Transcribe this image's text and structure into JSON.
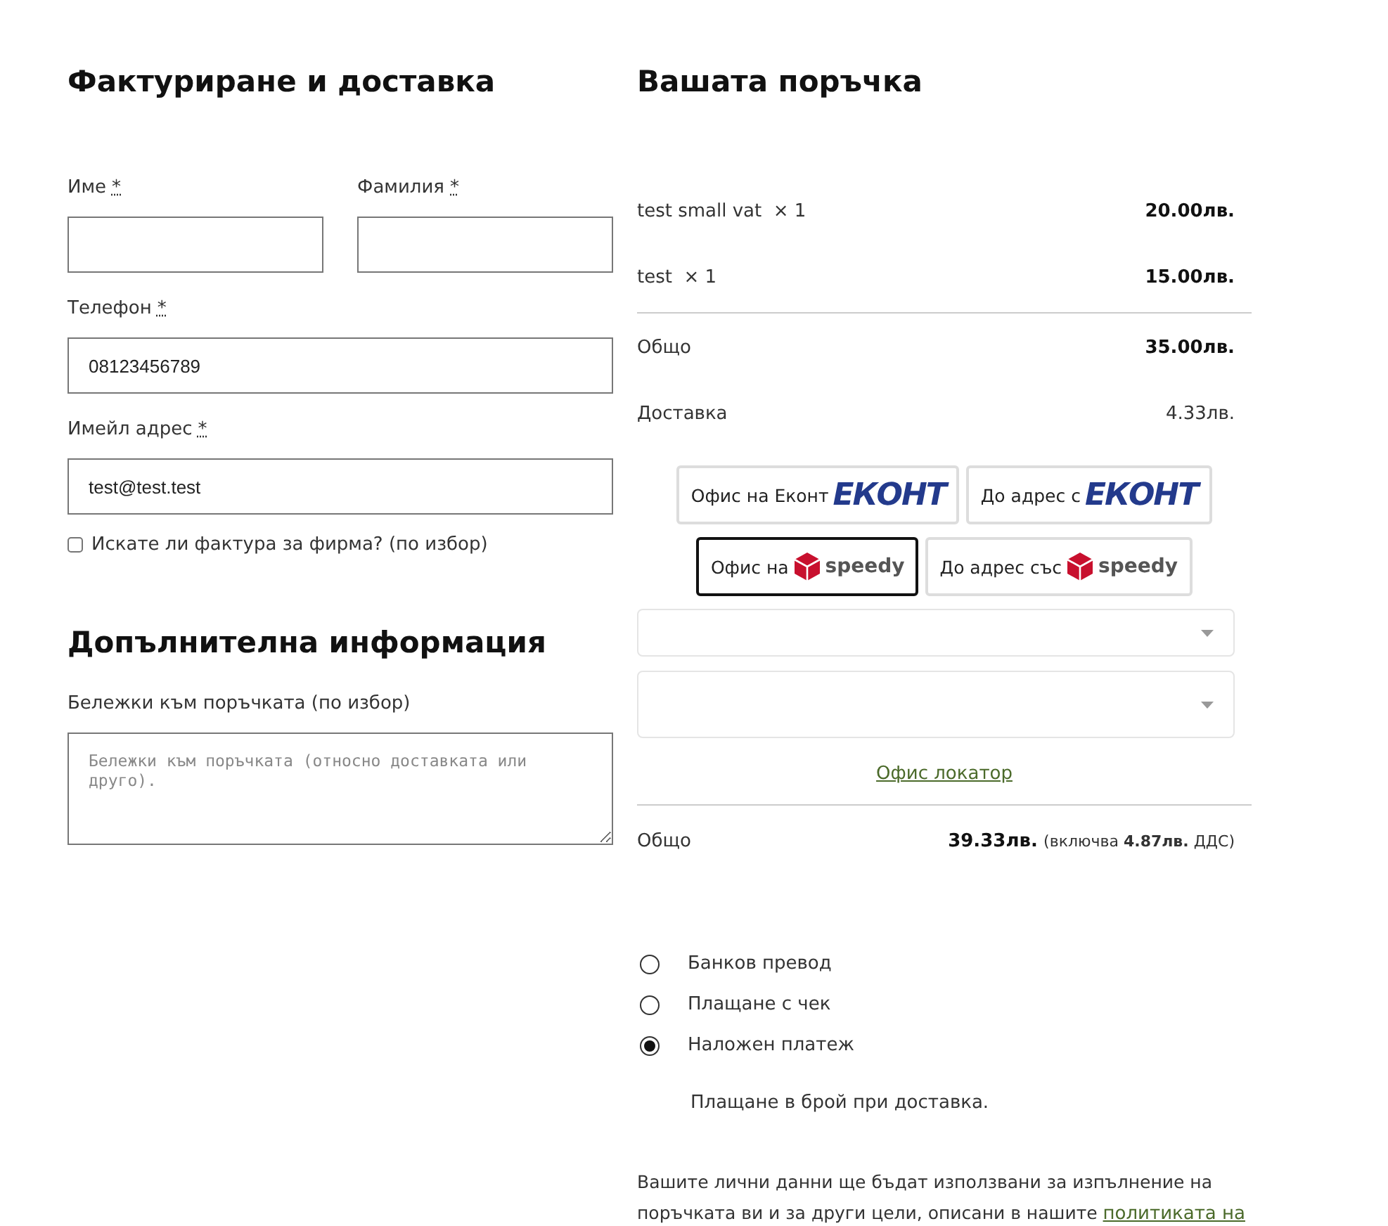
{
  "billing": {
    "title": "Фактуриране и доставка",
    "fields": [
      {
        "label": "Име",
        "required_mark": "*"
      },
      {
        "label": "Фамилия",
        "required_mark": "*"
      },
      {
        "label": "Телефон",
        "required_mark": "*",
        "value": "08123456789"
      },
      {
        "label": "Имейл адрес",
        "required_mark": "*",
        "value": "test@test.test"
      }
    ],
    "invoice_checkbox": {
      "label": "Искате ли фактура за фирма? (по избор)",
      "checked": false
    }
  },
  "additional": {
    "title": "Допълнителна информация",
    "notes_label": "Бележки към поръчката (по избор)",
    "notes_placeholder": "Бележки към поръчката (относно доставката или друго)."
  },
  "order": {
    "title": "Вашата поръчка",
    "items": [
      {
        "name": "test small vat",
        "qty": "× 1",
        "price": "20.00лв."
      },
      {
        "name": "test",
        "qty": "× 1",
        "price": "15.00лв."
      }
    ],
    "subtotal": {
      "label": "Общо",
      "value": "35.00лв."
    },
    "shipping": {
      "label": "Доставка",
      "value": "4.33лв."
    },
    "shipping_options": [
      {
        "label": "Офис на Еконт",
        "kind": "econt",
        "logo": "ЕКОНТ",
        "selected": false
      },
      {
        "label": "До адрес с",
        "kind": "econt",
        "logo": "ЕКОНТ",
        "selected": false
      },
      {
        "label": "Офис на",
        "kind": "speedy",
        "logo": "speedy",
        "selected": true
      },
      {
        "label": "До адрес със",
        "kind": "speedy",
        "logo": "speedy",
        "selected": false
      }
    ],
    "office_locator": "Офис локатор",
    "total": {
      "label": "Общо",
      "value": "39.33лв.",
      "tax_prefix": "(включва",
      "tax_value": "4.87лв.",
      "tax_suffix": "ДДС)"
    },
    "payment_methods": [
      {
        "label": "Банков превод",
        "selected": false
      },
      {
        "label": "Плащане с чек",
        "selected": false
      },
      {
        "label": "Наложен платеж",
        "selected": true
      }
    ],
    "payment_description": "Плащане в брой при доставка.",
    "privacy_text": "Вашите лични данни ще бъдат използвани за изпълнение на поръчката ви и за други цели, описани в нашите",
    "privacy_link": "политиката на"
  }
}
